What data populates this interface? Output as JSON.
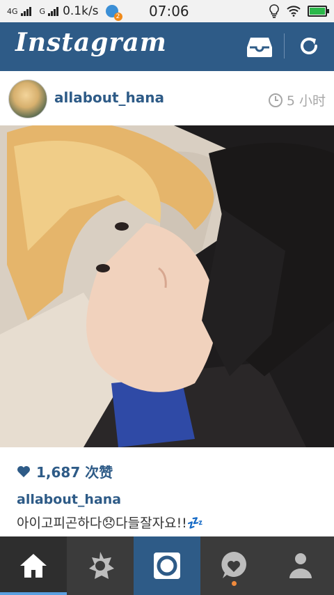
{
  "status_bar": {
    "net1": "4G",
    "net2": "G",
    "speed": "0.1k/s",
    "badge_count": "2",
    "time": "07:06",
    "battery_level": 1.0
  },
  "header": {
    "logo": "Instagram",
    "inbox_icon": "inbox-tray-icon",
    "refresh_icon": "refresh-icon"
  },
  "post": {
    "username": "allabout_hana",
    "time_ago": "5 小时",
    "likes": "1,687 次赞",
    "caption_user": "allabout_hana",
    "caption_text": "아이고피곤하다😞다들잘자요!!💤"
  },
  "tabs": [
    {
      "name": "home",
      "icon": "home-icon"
    },
    {
      "name": "explore",
      "icon": "star-icon"
    },
    {
      "name": "camera",
      "icon": "camera-icon"
    },
    {
      "name": "news",
      "icon": "heart-bubble-icon"
    },
    {
      "name": "profile",
      "icon": "person-icon"
    }
  ],
  "colors": {
    "brand": "#2e5b87",
    "notification_dot": "#f08a3c"
  }
}
